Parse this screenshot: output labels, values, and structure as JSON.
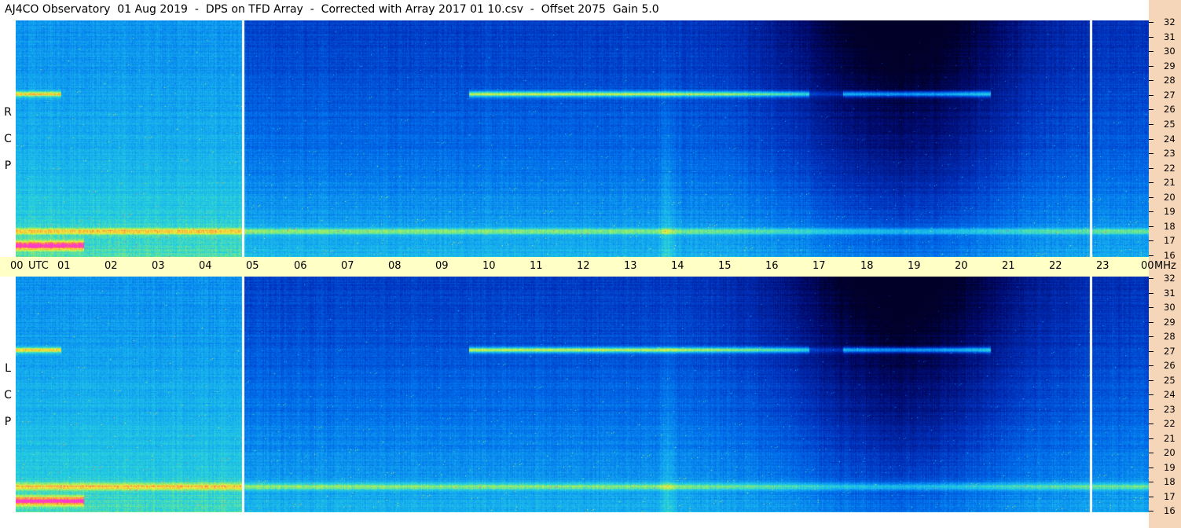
{
  "title": "AJ4CO Observatory  01 Aug 2019  -  DPS on TFD Array  -  Corrected with Array 2017 01 10.csv  -  Offset 2075  Gain 5.0",
  "chart_data": {
    "type": "heatmap",
    "title": "AJ4CO Observatory  01 Aug 2019  -  DPS on TFD Array  -  Corrected with Array 2017 01 10.csv  -  Offset 2075  Gain 5.0",
    "x_axis": {
      "unit_label": "UTC",
      "tick_labels": [
        "00",
        "01",
        "02",
        "03",
        "04",
        "05",
        "06",
        "07",
        "08",
        "09",
        "10",
        "11",
        "12",
        "13",
        "14",
        "15",
        "16",
        "17",
        "18",
        "19",
        "20",
        "21",
        "22",
        "23",
        "00"
      ],
      "range": [
        0,
        24
      ]
    },
    "y_axis": {
      "unit_label": "MHz",
      "tick_labels": [
        "32",
        "31",
        "30",
        "29",
        "28",
        "27",
        "26",
        "25",
        "24",
        "23",
        "22",
        "21",
        "20",
        "19",
        "18",
        "17",
        "16"
      ],
      "range": [
        16,
        32
      ]
    },
    "panels": [
      {
        "polarization": "RCP",
        "letters": [
          "R",
          "C",
          "P"
        ]
      },
      {
        "polarization": "LCP",
        "letters": [
          "L",
          "C",
          "P"
        ]
      }
    ]
  }
}
